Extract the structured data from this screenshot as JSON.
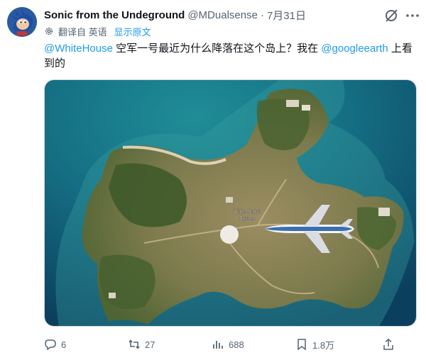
{
  "tweet": {
    "author_name": "Sonic from the Undeground",
    "handle": "@MDualsense",
    "separator": "·",
    "date": "7月31日",
    "translate_label": "翻译自 英语",
    "show_original": "显示原文",
    "text_parts": {
      "mention1": "@WhiteHouse",
      "middle": " 空军一号最近为什么降落在这个岛上？我在 ",
      "mention2": "@googleearth",
      "end": " 上看到的"
    },
    "media": {
      "map_label_line1": "Little Saint",
      "map_label_line2": "James"
    },
    "actions": {
      "replies": "6",
      "retweets": "27",
      "views": "688",
      "bookmarks": "1.8万"
    }
  },
  "icons": {
    "grok": "grok-slash-icon",
    "more": "more-dots-icon",
    "translate": "gear-icon",
    "reply": "reply-icon",
    "retweet": "retweet-icon",
    "views": "views-bar-icon",
    "bookmark": "bookmark-icon",
    "share": "share-icon"
  },
  "colors": {
    "link": "#1d9bf0",
    "secondary_text": "#536471",
    "primary_text": "#0f1419"
  }
}
